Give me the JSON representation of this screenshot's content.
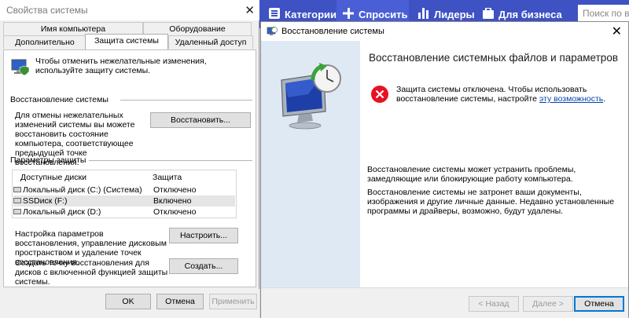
{
  "web": {
    "nav": [
      {
        "label": "Категории"
      },
      {
        "label": "Спросить"
      },
      {
        "label": "Лидеры"
      },
      {
        "label": "Для бизнеса"
      }
    ],
    "search_placeholder": "Поиск по в"
  },
  "sysprops": {
    "title": "Свойства системы",
    "tabs_top": [
      "Имя компьютера",
      "Оборудование"
    ],
    "tabs_bottom": [
      "Дополнительно",
      "Защита системы",
      "Удаленный доступ"
    ],
    "intro": "Чтобы отменить нежелательные изменения, используйте защиту системы.",
    "restore_section": "Восстановление системы",
    "restore_desc": "Для отмены нежелательных изменений системы вы можете восстановить состояние компьютера, соответствующее предыдущей точке восстановления.",
    "restore_btn": "Восстановить...",
    "params_section": "Параметры защиты",
    "col_drives": "Доступные диски",
    "col_protection": "Защита",
    "drives": [
      {
        "name": "Локальный диск (C:) (Система)",
        "protection": "Отключено"
      },
      {
        "name": "SSDиск (F:)",
        "protection": "Включено"
      },
      {
        "name": "Локальный диск (D:)",
        "protection": "Отключено"
      }
    ],
    "configure_desc": "Настройка параметров восстановления, управление дисковым пространством и удаление точек восстановления.",
    "configure_btn": "Настроить...",
    "create_desc": "Создать точку восстановления для дисков с включенной функцией защиты системы.",
    "create_btn": "Создать...",
    "ok": "OK",
    "cancel": "Отмена",
    "apply": "Применить"
  },
  "restore": {
    "title": "Восстановление системы",
    "heading": "Восстановление системных файлов и параметров",
    "warn_pre": "Защита системы отключена. Чтобы использовать восстановление системы, настройте ",
    "warn_link": "эту возможность",
    "warn_post": ".",
    "para1": "Восстановление системы может устранить проблемы, замедляющие или блокирующие работу компьютера.",
    "para2": "Восстановление системы не затронет ваши документы, изображения и другие личные данные. Недавно установленные программы и драйверы, возможно, будут удалены.",
    "back": "< Назад",
    "next": "Далее >",
    "cancel": "Отмена"
  },
  "colors": {
    "web_bar": "#3f52c4",
    "accent": "#0078d7",
    "error": "#e81123",
    "link": "#0645ad"
  }
}
